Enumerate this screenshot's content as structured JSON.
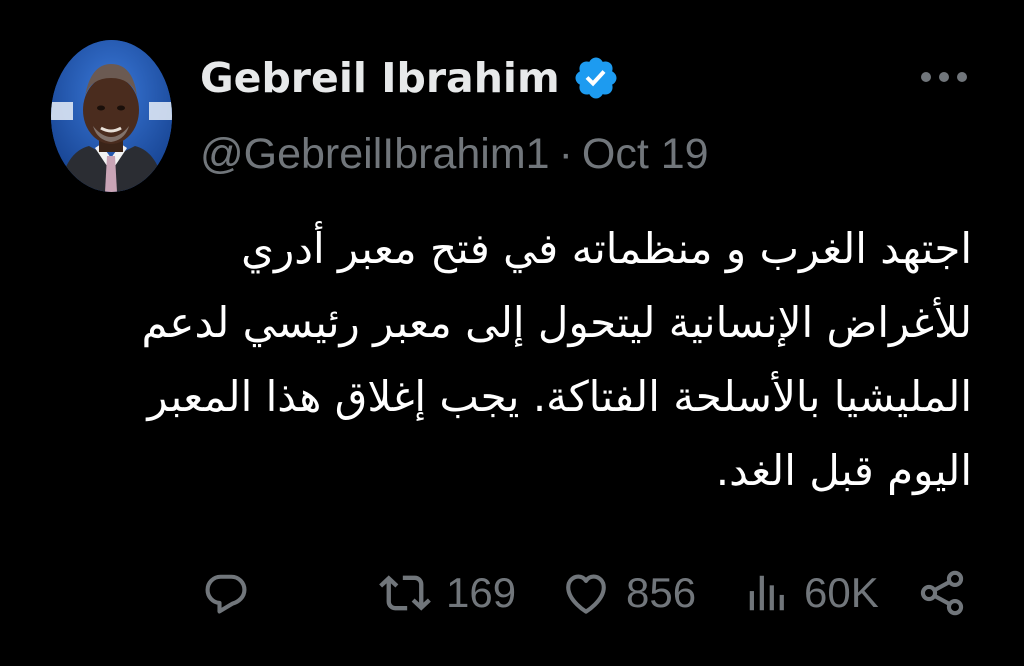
{
  "author": {
    "display_name": "Gebreil Ibrahim",
    "handle": "@GebreilIbrahim1",
    "separator": "·",
    "date": "Oct 19",
    "verified": true
  },
  "tweet": {
    "lines": [
      "اجتهد الغرب و منظماته في فتح معبر أدري",
      "للأغراض الإنسانية ليتحول إلى معبر رئيسي لدعم",
      "المليشيا بالأسلحة الفتاكة. يجب إغلاق هذا المعبر",
      "اليوم قبل الغد."
    ]
  },
  "actions": {
    "replies": "",
    "retweets": "169",
    "likes": "856",
    "views": "60K"
  },
  "icons": {
    "avatar": "avatar-photo",
    "verified": "verified-badge-icon",
    "more": "more-options-icon",
    "reply": "reply-icon",
    "retweet": "retweet-icon",
    "like": "heart-icon",
    "views": "views-chart-icon",
    "share": "share-icon"
  },
  "colors": {
    "background": "#000000",
    "text_primary": "#e7e9ea",
    "text_secondary": "#71767b",
    "verified_blue": "#1d9bf0"
  }
}
